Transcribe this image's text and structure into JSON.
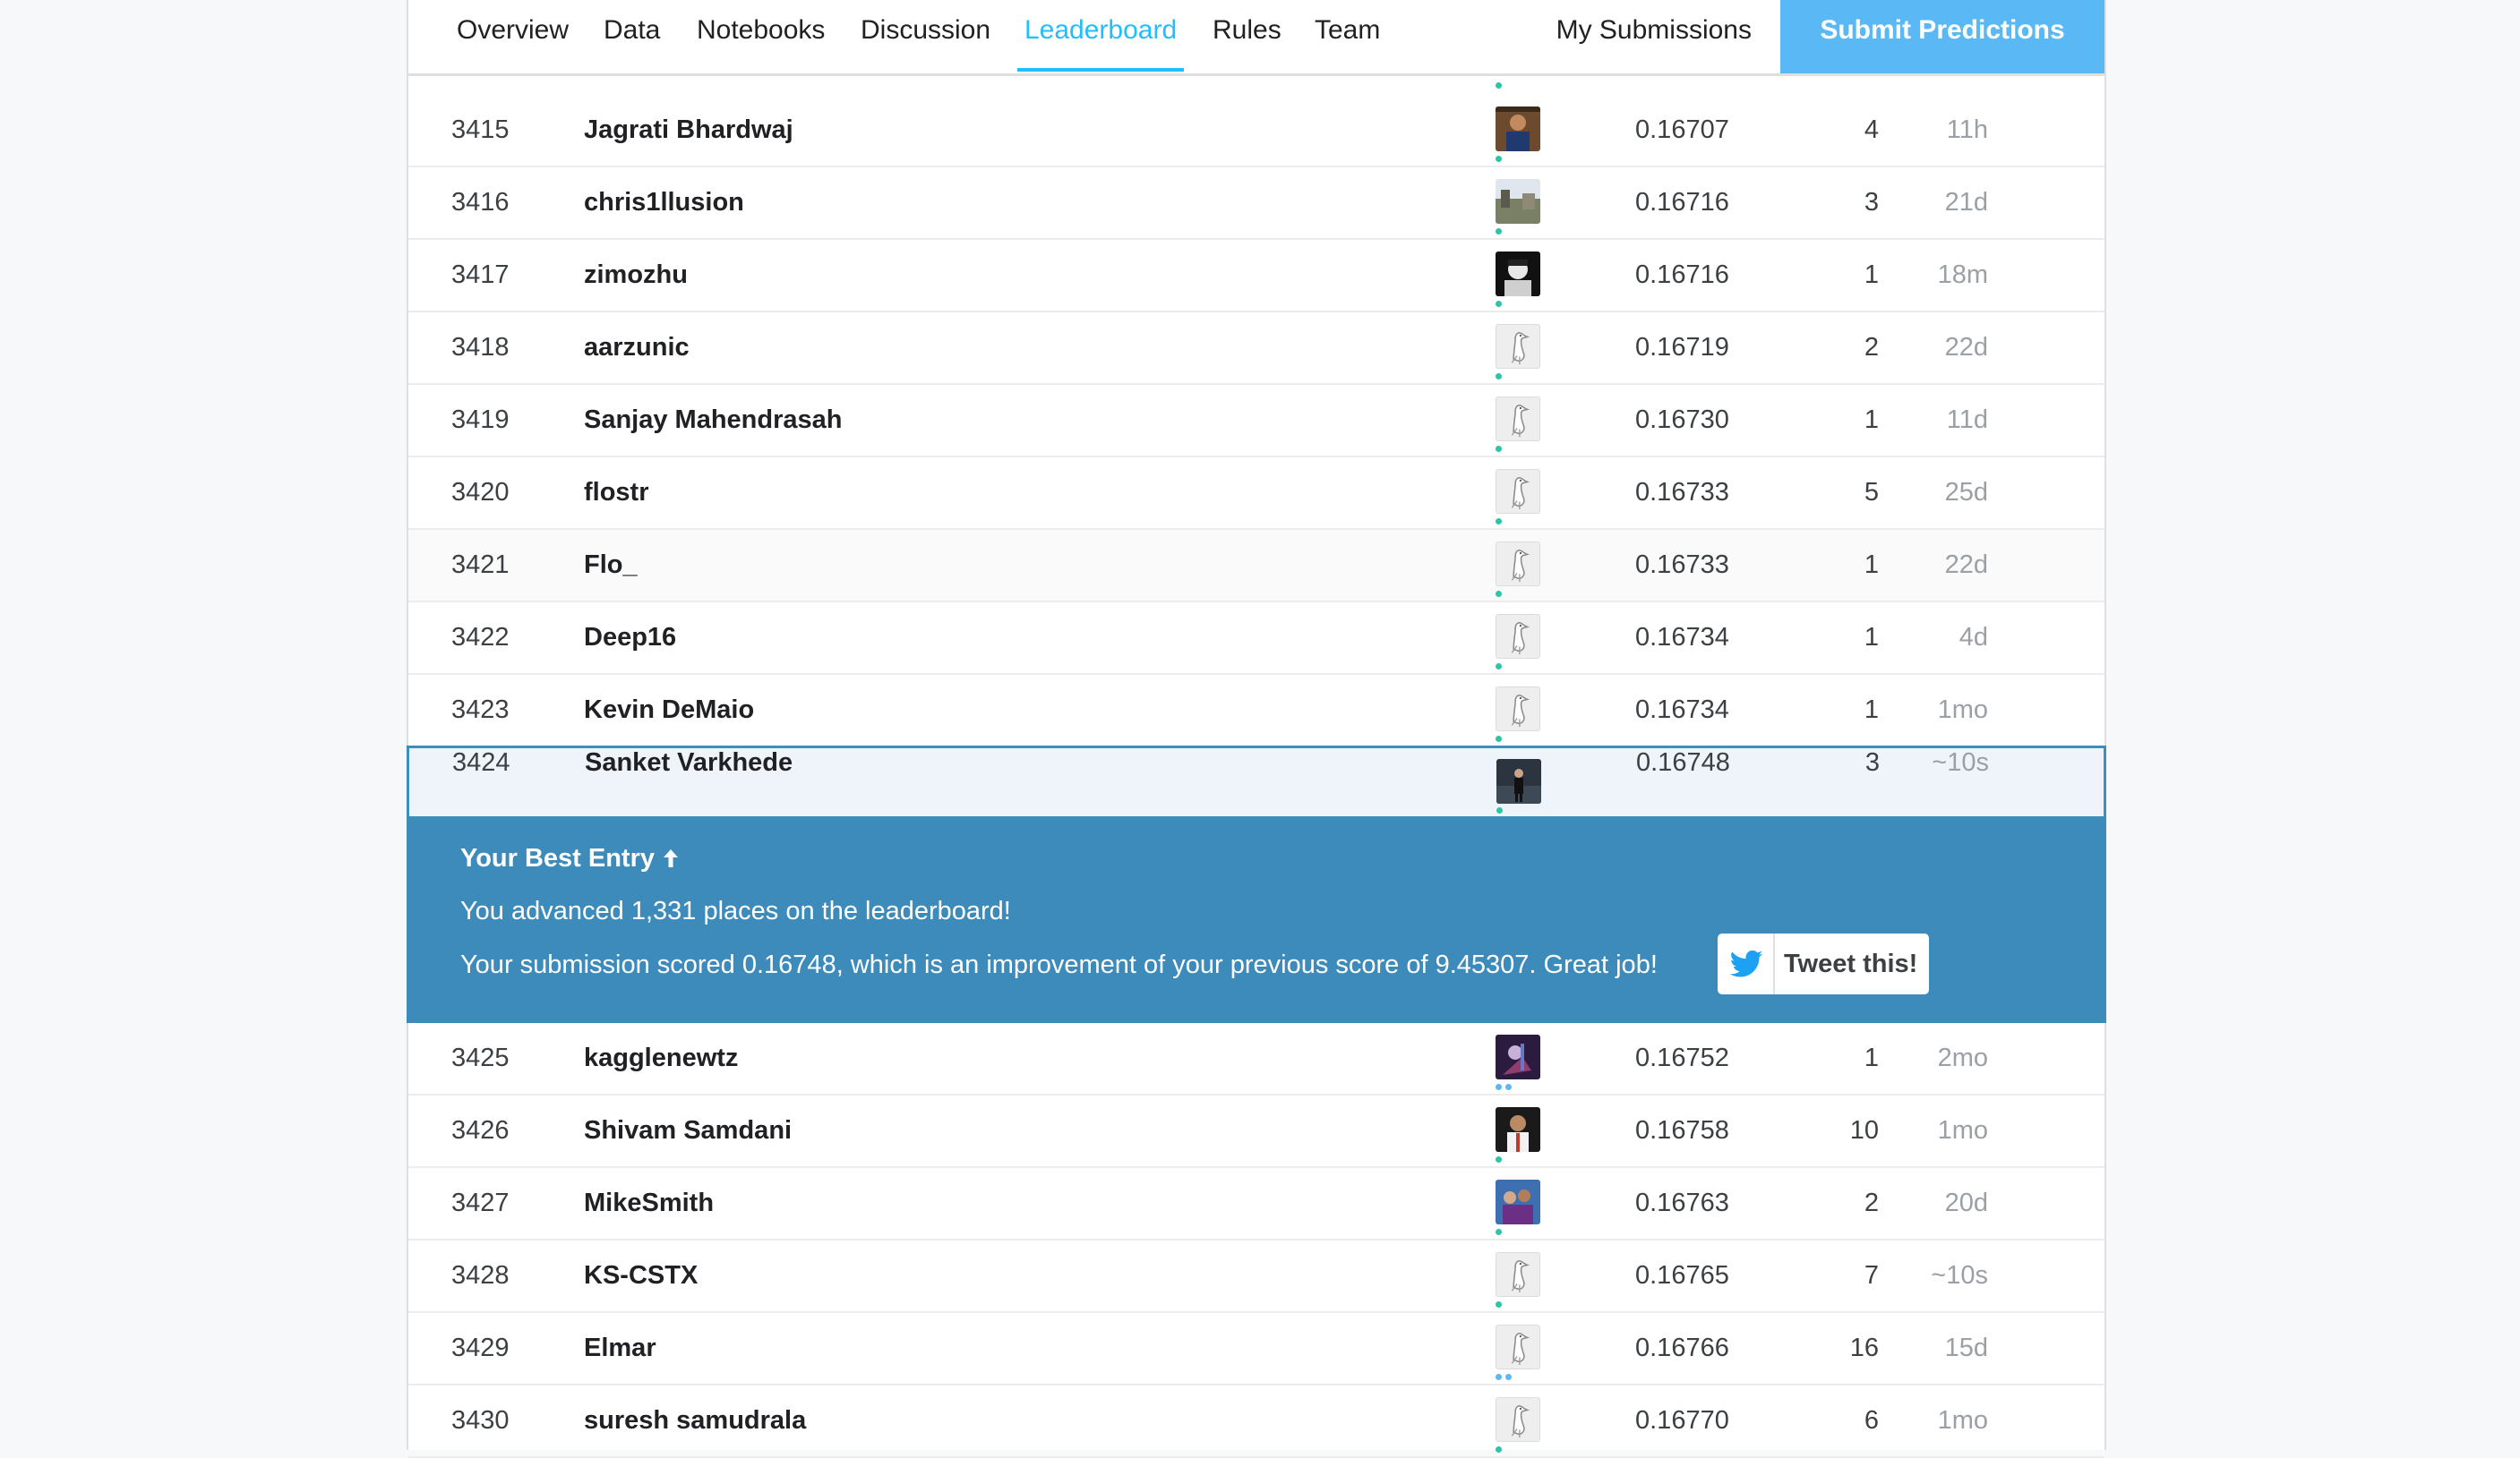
{
  "nav": {
    "tabs": [
      "Overview",
      "Data",
      "Notebooks",
      "Discussion",
      "Leaderboard",
      "Rules",
      "Team"
    ],
    "active_tab": "Leaderboard",
    "my_submissions": "My Submissions",
    "submit": "Submit Predictions"
  },
  "rows_top": [
    {
      "rank": "3415",
      "name": "Jagrati Bhardwaj",
      "score": "0.16707",
      "entries": "4",
      "last": "11h",
      "avatar": "photo"
    },
    {
      "rank": "3416",
      "name": "chris1llusion",
      "score": "0.16716",
      "entries": "3",
      "last": "21d",
      "avatar": "photo"
    },
    {
      "rank": "3417",
      "name": "zimozhu",
      "score": "0.16716",
      "entries": "1",
      "last": "18m",
      "avatar": "photo"
    },
    {
      "rank": "3418",
      "name": "aarzunic",
      "score": "0.16719",
      "entries": "2",
      "last": "22d",
      "avatar": "goose"
    },
    {
      "rank": "3419",
      "name": "Sanjay Mahendrasah",
      "score": "0.16730",
      "entries": "1",
      "last": "11d",
      "avatar": "goose"
    },
    {
      "rank": "3420",
      "name": "flostr",
      "score": "0.16733",
      "entries": "5",
      "last": "25d",
      "avatar": "goose"
    },
    {
      "rank": "3421",
      "name": "Flo_",
      "score": "0.16733",
      "entries": "1",
      "last": "22d",
      "avatar": "goose"
    },
    {
      "rank": "3422",
      "name": "Deep16",
      "score": "0.16734",
      "entries": "1",
      "last": "4d",
      "avatar": "goose"
    },
    {
      "rank": "3423",
      "name": "Kevin DeMaio",
      "score": "0.16734",
      "entries": "1",
      "last": "1mo",
      "avatar": "goose"
    }
  ],
  "user_row": {
    "rank": "3424",
    "name": "Sanket Varkhede",
    "score": "0.16748",
    "entries": "3",
    "last": "~10s",
    "avatar": "photo"
  },
  "banner": {
    "title": "Your Best Entry",
    "title_icon": "arrow-up-icon",
    "line1": "You advanced 1,331 places on the leaderboard!",
    "line2": "Your submission scored 0.16748, which is an improvement of your previous score of 9.45307. Great job!",
    "tweet": "Tweet this!",
    "tweet_icon": "twitter-bird-icon"
  },
  "rows_bottom": [
    {
      "rank": "3425",
      "name": "kagglenewtz",
      "score": "0.16752",
      "entries": "1",
      "last": "2mo",
      "avatar": "photo"
    },
    {
      "rank": "3426",
      "name": "Shivam Samdani",
      "score": "0.16758",
      "entries": "10",
      "last": "1mo",
      "avatar": "photo"
    },
    {
      "rank": "3427",
      "name": "MikeSmith",
      "score": "0.16763",
      "entries": "2",
      "last": "20d",
      "avatar": "photo"
    },
    {
      "rank": "3428",
      "name": "KS-CSTX",
      "score": "0.16765",
      "entries": "7",
      "last": "~10s",
      "avatar": "goose"
    },
    {
      "rank": "3429",
      "name": "Elmar",
      "score": "0.16766",
      "entries": "16",
      "last": "15d",
      "avatar": "goose"
    },
    {
      "rank": "3430",
      "name": "suresh samudrala",
      "score": "0.16770",
      "entries": "6",
      "last": "1mo",
      "avatar": "goose"
    }
  ],
  "colors": {
    "accent": "#20beff",
    "banner": "#3d8bba",
    "submit": "#5ab9f5",
    "medal_dot": "#2ec4a6"
  }
}
